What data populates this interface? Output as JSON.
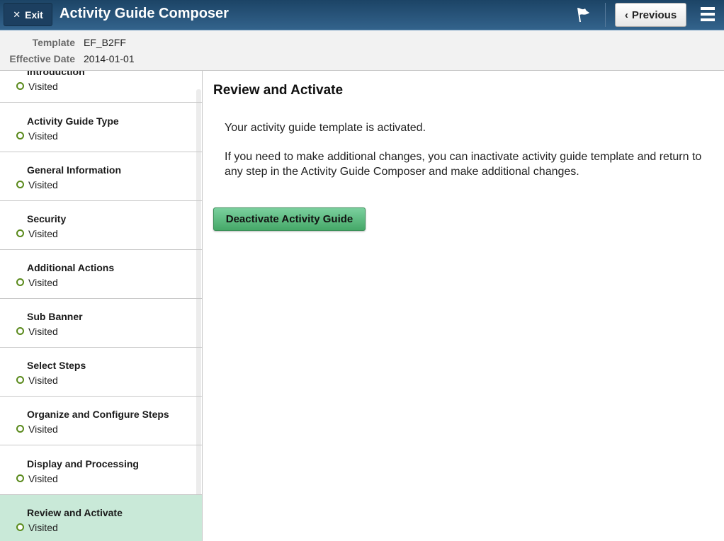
{
  "header": {
    "exit_label": "Exit",
    "title": "Activity Guide Composer",
    "previous_label": "Previous"
  },
  "info": {
    "template_label": "Template",
    "template_value": "EF_B2FF",
    "effective_date_label": "Effective Date",
    "effective_date_value": "2014-01-01"
  },
  "steps": [
    {
      "title": "Introduction",
      "status": "Visited"
    },
    {
      "title": "Activity Guide Type",
      "status": "Visited"
    },
    {
      "title": "General Information",
      "status": "Visited"
    },
    {
      "title": "Security",
      "status": "Visited"
    },
    {
      "title": "Additional Actions",
      "status": "Visited"
    },
    {
      "title": "Sub Banner",
      "status": "Visited"
    },
    {
      "title": "Select Steps",
      "status": "Visited"
    },
    {
      "title": "Organize and Configure Steps",
      "status": "Visited"
    },
    {
      "title": "Display and Processing",
      "status": "Visited"
    },
    {
      "title": "Review and Activate",
      "status": "Visited",
      "active": true
    }
  ],
  "main": {
    "title": "Review and Activate",
    "message": "Your activity guide template is activated.",
    "detail": "If you need to make additional changes, you can inactivate activity guide template and return to any step in the Activity Guide Composer and make additional changes.",
    "deactivate_label": "Deactivate Activity Guide"
  }
}
